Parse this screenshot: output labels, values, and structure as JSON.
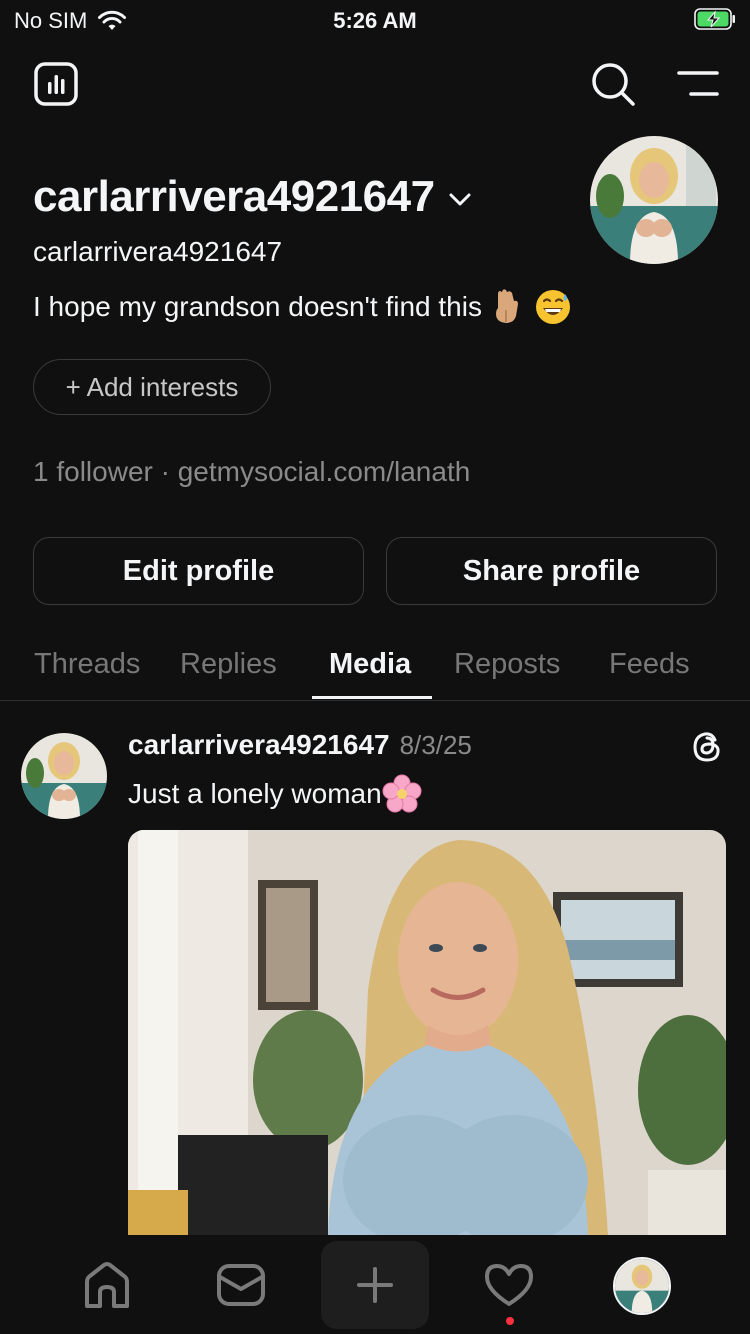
{
  "status_bar": {
    "carrier": "No SIM",
    "time": "5:26 AM"
  },
  "profile": {
    "display_name": "carlarrivera4921647",
    "handle": "carlarrivera4921647",
    "bio": "I hope my grandson doesn't find this",
    "interests_button": "+ Add interests",
    "followers_line": "1 follower · getmysocial.com/lanath",
    "edit_button": "Edit profile",
    "share_button": "Share profile"
  },
  "tabs": [
    {
      "label": "Threads"
    },
    {
      "label": "Replies"
    },
    {
      "label": "Media"
    },
    {
      "label": "Reposts"
    },
    {
      "label": "Feeds"
    }
  ],
  "active_tab": "Media",
  "post": {
    "username": "carlarrivera4921647",
    "date": "8/3/25",
    "text": "Just a lonely woman"
  },
  "bottom_nav": [
    "home-icon",
    "messages-icon",
    "create-icon",
    "activity-icon",
    "profile-avatar"
  ],
  "colors": {
    "background": "#101010",
    "text": "#f3f5f7",
    "muted": "#8a8a8a",
    "notification_dot": "#ff3040",
    "battery": "#4cd964"
  }
}
